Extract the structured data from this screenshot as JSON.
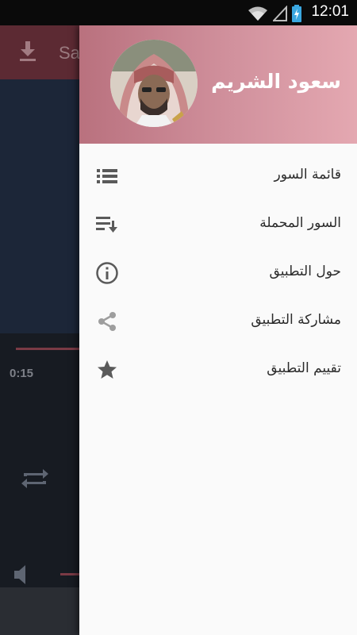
{
  "status_bar": {
    "time": "12:01"
  },
  "background_app": {
    "toolbar_title": "Sa",
    "elapsed_time": "0:15"
  },
  "drawer": {
    "header": {
      "name": "سعود الشريم"
    },
    "items": [
      {
        "label": "قائمة السور",
        "icon": "list-icon"
      },
      {
        "label": "السور المحملة",
        "icon": "download-list-icon"
      },
      {
        "label": "حول التطبيق",
        "icon": "info-icon"
      },
      {
        "label": "مشاركة التطبيق",
        "icon": "share-icon"
      },
      {
        "label": "تقييم التطبيق",
        "icon": "star-icon"
      }
    ]
  },
  "colors": {
    "header_gradient_start": "#b9717e",
    "header_gradient_end": "#e4a8b1",
    "icon_color": "#5a5a5a",
    "background_toolbar": "#5c2a33"
  }
}
